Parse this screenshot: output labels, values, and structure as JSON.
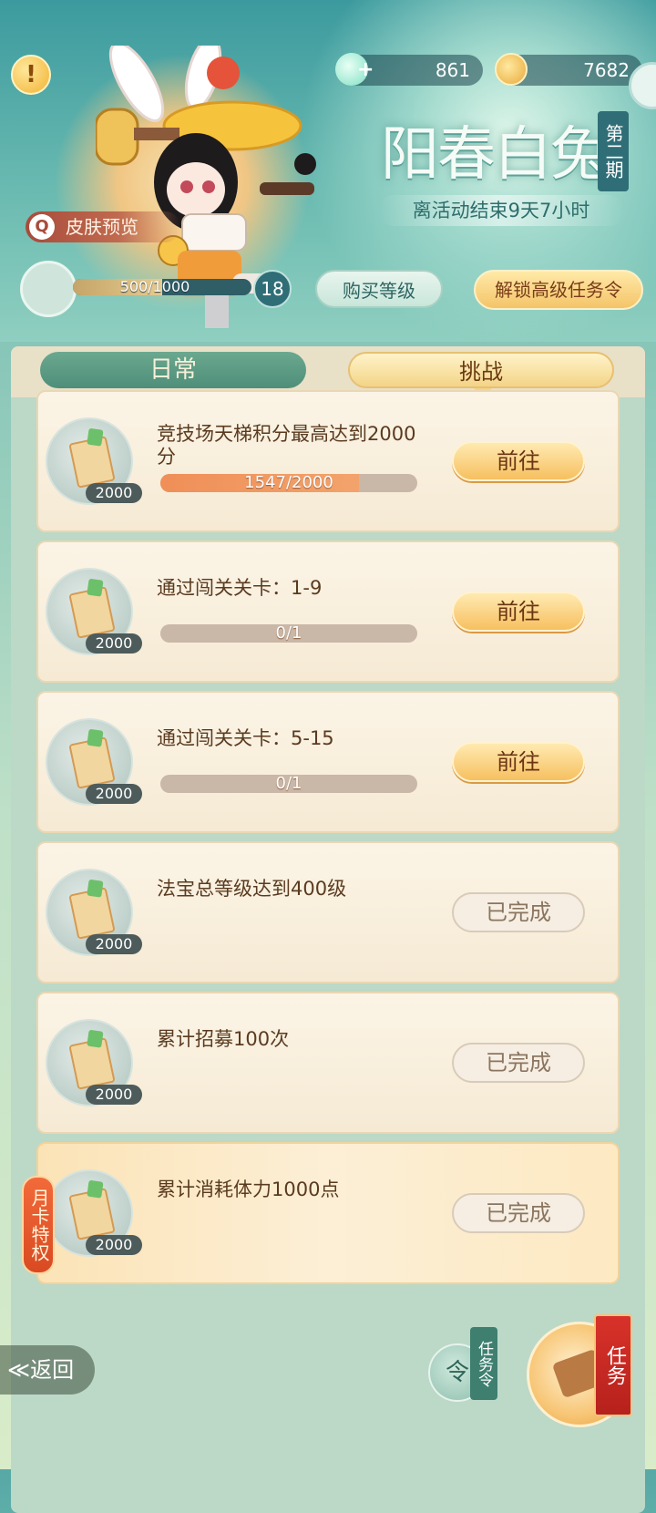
{
  "header": {
    "title": "阳春白兔",
    "period_tag": "第二期",
    "countdown": "离活动结束9天7小时",
    "skin_preview": "皮肤预览",
    "warning_icon": "!"
  },
  "resources": {
    "jade": {
      "value": "861",
      "icon": "jade-plus-icon"
    },
    "gold": {
      "value": "7682",
      "icon": "gold-coin-icon"
    }
  },
  "level": {
    "xp_text": "500/1000",
    "xp_fraction": 0.5,
    "level": "18",
    "buy_label": "购买等级",
    "unlock_label": "解锁高级任务令"
  },
  "tabs": {
    "daily": "日常",
    "challenge": "挑战"
  },
  "tasks": [
    {
      "text": "竞技场天梯积分最高达到2000分",
      "reward": "2000",
      "progress_text": "1547/2000",
      "progress": 0.7735,
      "button": "前往",
      "status": "go"
    },
    {
      "text": "通过闯关关卡：1-9",
      "reward": "2000",
      "progress_text": "0/1",
      "progress": 0,
      "button": "前往",
      "status": "go"
    },
    {
      "text": "通过闯关关卡：5-15",
      "reward": "2000",
      "progress_text": "0/1",
      "progress": 0,
      "button": "前往",
      "status": "go"
    },
    {
      "text": "法宝总等级达到400级",
      "reward": "2000",
      "button": "已完成",
      "status": "done"
    },
    {
      "text": "累计招募100次",
      "reward": "2000",
      "button": "已完成",
      "status": "done"
    },
    {
      "text": "累计消耗体力1000点",
      "reward": "2000",
      "button": "已完成",
      "status": "done"
    }
  ],
  "month_card_badge": "月卡特权",
  "footer": {
    "back": "≪返回",
    "order_char": "令",
    "order_label": "任务令",
    "task_label": "任务"
  },
  "colors": {
    "accent_gold": "#f6c060",
    "teal": "#2f6e77",
    "progress_orange": "#f08f58"
  }
}
